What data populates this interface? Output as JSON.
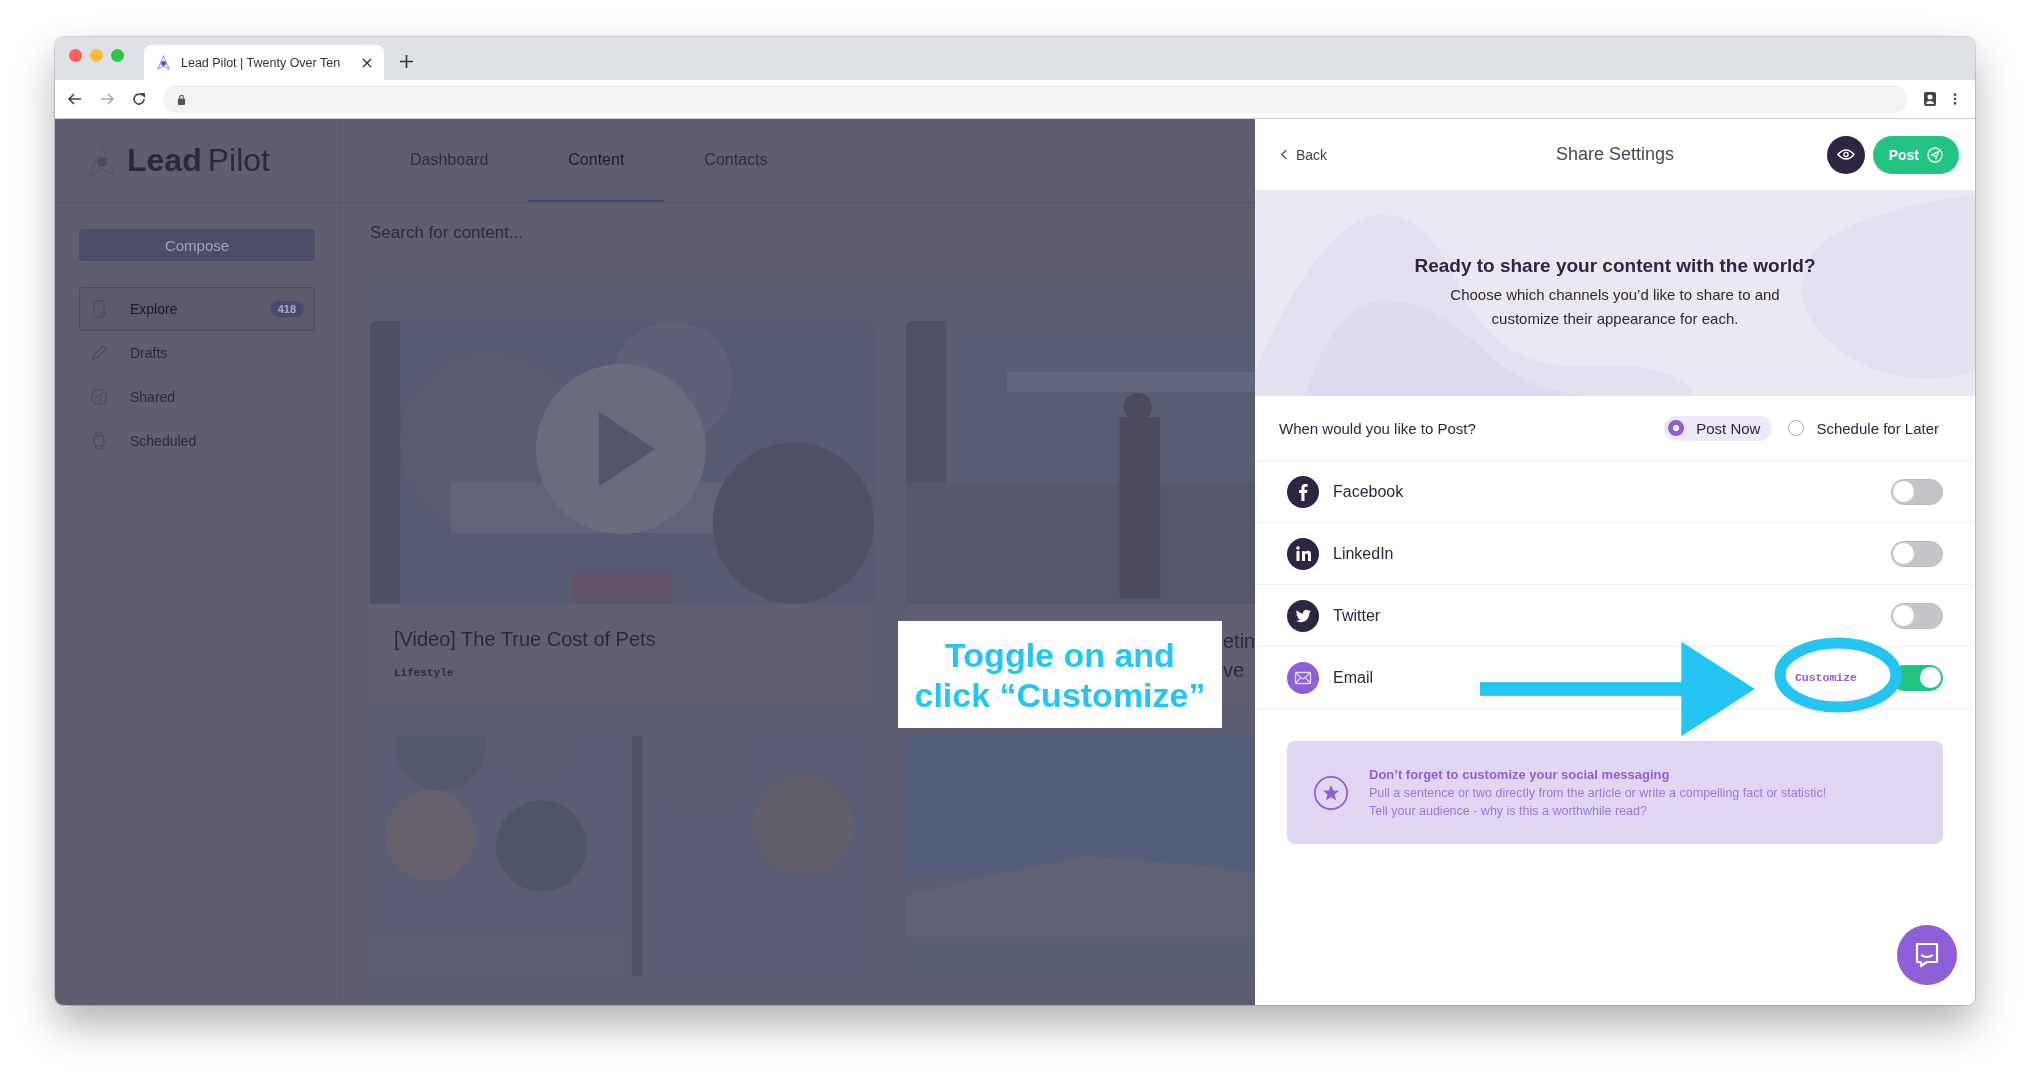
{
  "browser": {
    "tab_title": "Lead Pilot | Twenty Over Ten"
  },
  "app": {
    "logo_bold": "Lead",
    "logo_light": "Pilot",
    "nav": [
      {
        "label": "Dashboard",
        "selected": false
      },
      {
        "label": "Content",
        "selected": true
      },
      {
        "label": "Contacts",
        "selected": false
      }
    ],
    "compose": "Compose",
    "search": {
      "placeholder": "Search for content..."
    },
    "sidebar": {
      "items": [
        {
          "label": "Explore",
          "kind": "explore",
          "badge": "418",
          "selected": true
        },
        {
          "label": "Drafts",
          "kind": "drafts",
          "selected": false
        },
        {
          "label": "Shared",
          "kind": "shared",
          "selected": false
        },
        {
          "label": "Scheduled",
          "kind": "scheduled",
          "selected": false
        }
      ]
    },
    "cards": [
      {
        "title": "[Video] The True Cost of Pets",
        "tag": "Lifestyle",
        "kind": "video"
      },
      {
        "title_fragments": [
          "etin",
          "ve"
        ]
      }
    ]
  },
  "panel": {
    "back": "Back",
    "title": "Share Settings",
    "post": "Post",
    "hero": {
      "heading": "Ready to share your content with the world?",
      "text": "Choose which channels you’d like to share to and customize their appearance for each."
    },
    "when": {
      "label": "When would you like to Post?",
      "options": [
        {
          "label": "Post Now",
          "selected": true
        },
        {
          "label": "Schedule for Later",
          "selected": false
        }
      ]
    },
    "channels": [
      {
        "name": "Facebook",
        "kind": "facebook",
        "on": false
      },
      {
        "name": "LinkedIn",
        "kind": "linkedin",
        "on": false
      },
      {
        "name": "Twitter",
        "kind": "twitter",
        "on": false
      },
      {
        "name": "Email",
        "kind": "email",
        "on": true,
        "customize": "Customize"
      }
    ],
    "tip": {
      "title": "Don’t forget to customize your social messaging",
      "lines": [
        "Pull a sentence or two directly from the article or write a compelling fact or statistic!",
        "Tell your audience - why is this a worthwhile read?"
      ]
    }
  },
  "annotation": {
    "lines": [
      "Toggle on and",
      "click “Customize”"
    ]
  }
}
